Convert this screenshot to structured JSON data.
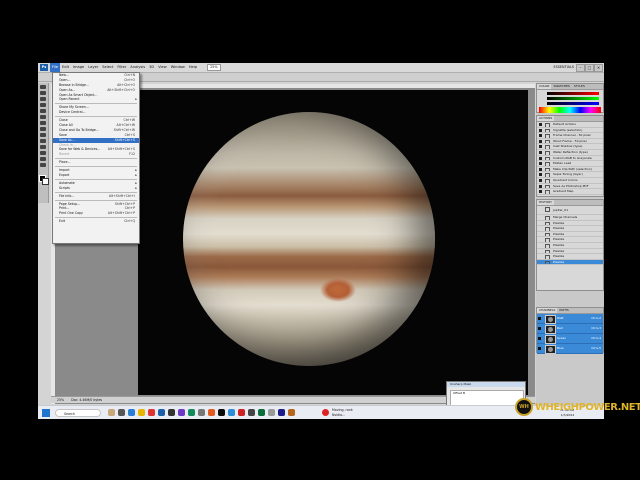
{
  "menubar": {
    "logo": "Ps",
    "items": [
      "File",
      "Edit",
      "Image",
      "Layer",
      "Select",
      "Filter",
      "Analysis",
      "3D",
      "View",
      "Window",
      "Help"
    ],
    "zoom": "25%",
    "workspace": "ESSENTIALS"
  },
  "file_menu": {
    "items": [
      {
        "label": "New...",
        "shortcut": "Ctrl+N"
      },
      {
        "label": "Open...",
        "shortcut": "Ctrl+O"
      },
      {
        "label": "Browse in Bridge...",
        "shortcut": "Alt+Ctrl+O"
      },
      {
        "label": "Open As...",
        "shortcut": "Alt+Shift+Ctrl+O"
      },
      {
        "label": "Open As Smart Object...",
        "shortcut": ""
      },
      {
        "label": "Open Recent",
        "shortcut": ""
      },
      {
        "label": "Share My Screen...",
        "shortcut": ""
      },
      {
        "label": "Device Central...",
        "shortcut": ""
      },
      {
        "label": "Close",
        "shortcut": "Ctrl+W"
      },
      {
        "label": "Close All",
        "shortcut": "Alt+Ctrl+W"
      },
      {
        "label": "Close and Go To Bridge...",
        "shortcut": "Shift+Ctrl+W"
      },
      {
        "label": "Save",
        "shortcut": "Ctrl+S"
      },
      {
        "label": "Save As...",
        "shortcut": "Shift+Ctrl+S"
      },
      {
        "label": "Check In...",
        "shortcut": ""
      },
      {
        "label": "Save for Web & Devices...",
        "shortcut": "Alt+Shift+Ctrl+S"
      },
      {
        "label": "Revert",
        "shortcut": "F12"
      },
      {
        "label": "Place...",
        "shortcut": ""
      },
      {
        "label": "Import",
        "shortcut": ""
      },
      {
        "label": "Export",
        "shortcut": ""
      },
      {
        "label": "Automate",
        "shortcut": ""
      },
      {
        "label": "Scripts",
        "shortcut": ""
      },
      {
        "label": "File Info...",
        "shortcut": "Alt+Shift+Ctrl+I"
      },
      {
        "label": "Page Setup...",
        "shortcut": "Shift+Ctrl+P"
      },
      {
        "label": "Print...",
        "shortcut": "Ctrl+P"
      },
      {
        "label": "Print One Copy",
        "shortcut": "Alt+Shift+Ctrl+P"
      },
      {
        "label": "Exit",
        "shortcut": "Ctrl+Q"
      }
    ]
  },
  "color_panel": {
    "tabs": [
      "COLOR",
      "SWATCHES",
      "STYLES"
    ]
  },
  "actions_panel": {
    "tabs": [
      "ACTIONS"
    ],
    "items": [
      "Default Actions",
      "Vignette (selection)",
      "Frame Channel - 50 pixel",
      "Wood Frame - 50 pixel",
      "Cast Shadow (type)",
      "Water Reflection (type)",
      "Custom RGB to Grayscale",
      "Molten Lead",
      "Make Clip Path (selection)",
      "Sepia Toning (layer)",
      "Quadrant Colors",
      "Save As Photoshop PDF",
      "Gradient Map"
    ]
  },
  "history_panel": {
    "tabs": [
      "HISTORY"
    ],
    "snapshot": "Jupiter_01",
    "items": [
      "Merge Channels",
      "Pixelize",
      "Pixelize",
      "Pixelize",
      "Pixelize",
      "Pixelize",
      "Pixelize",
      "Pixelize",
      "Pixelize"
    ]
  },
  "channels_panel": {
    "tabs": [
      "CHANNELS",
      "PATHS"
    ],
    "items": [
      {
        "label": "RGB",
        "shortcut": "Ctrl+2"
      },
      {
        "label": "Red",
        "shortcut": "Ctrl+3"
      },
      {
        "label": "Green",
        "shortcut": "Ctrl+4"
      },
      {
        "label": "Blue",
        "shortcut": "Ctrl+5"
      }
    ]
  },
  "status": {
    "zoom": "25%",
    "doc": "Doc: 4.46M/0 bytes"
  },
  "dialog": {
    "title": "Unsharp Mask",
    "label": "Offset B"
  },
  "taskbar": {
    "search_placeholder": "Search",
    "note_line1": "Moving, rank",
    "note_line2": "Nvidia...",
    "time": "11:49 AM",
    "date": "1/3/2024"
  },
  "watermark": {
    "badge": "WH",
    "text": "WHEIGHPOWER.NET"
  },
  "colors": {
    "menu_highlight": "#3170c4",
    "panel_selection": "#3b8ad8"
  }
}
